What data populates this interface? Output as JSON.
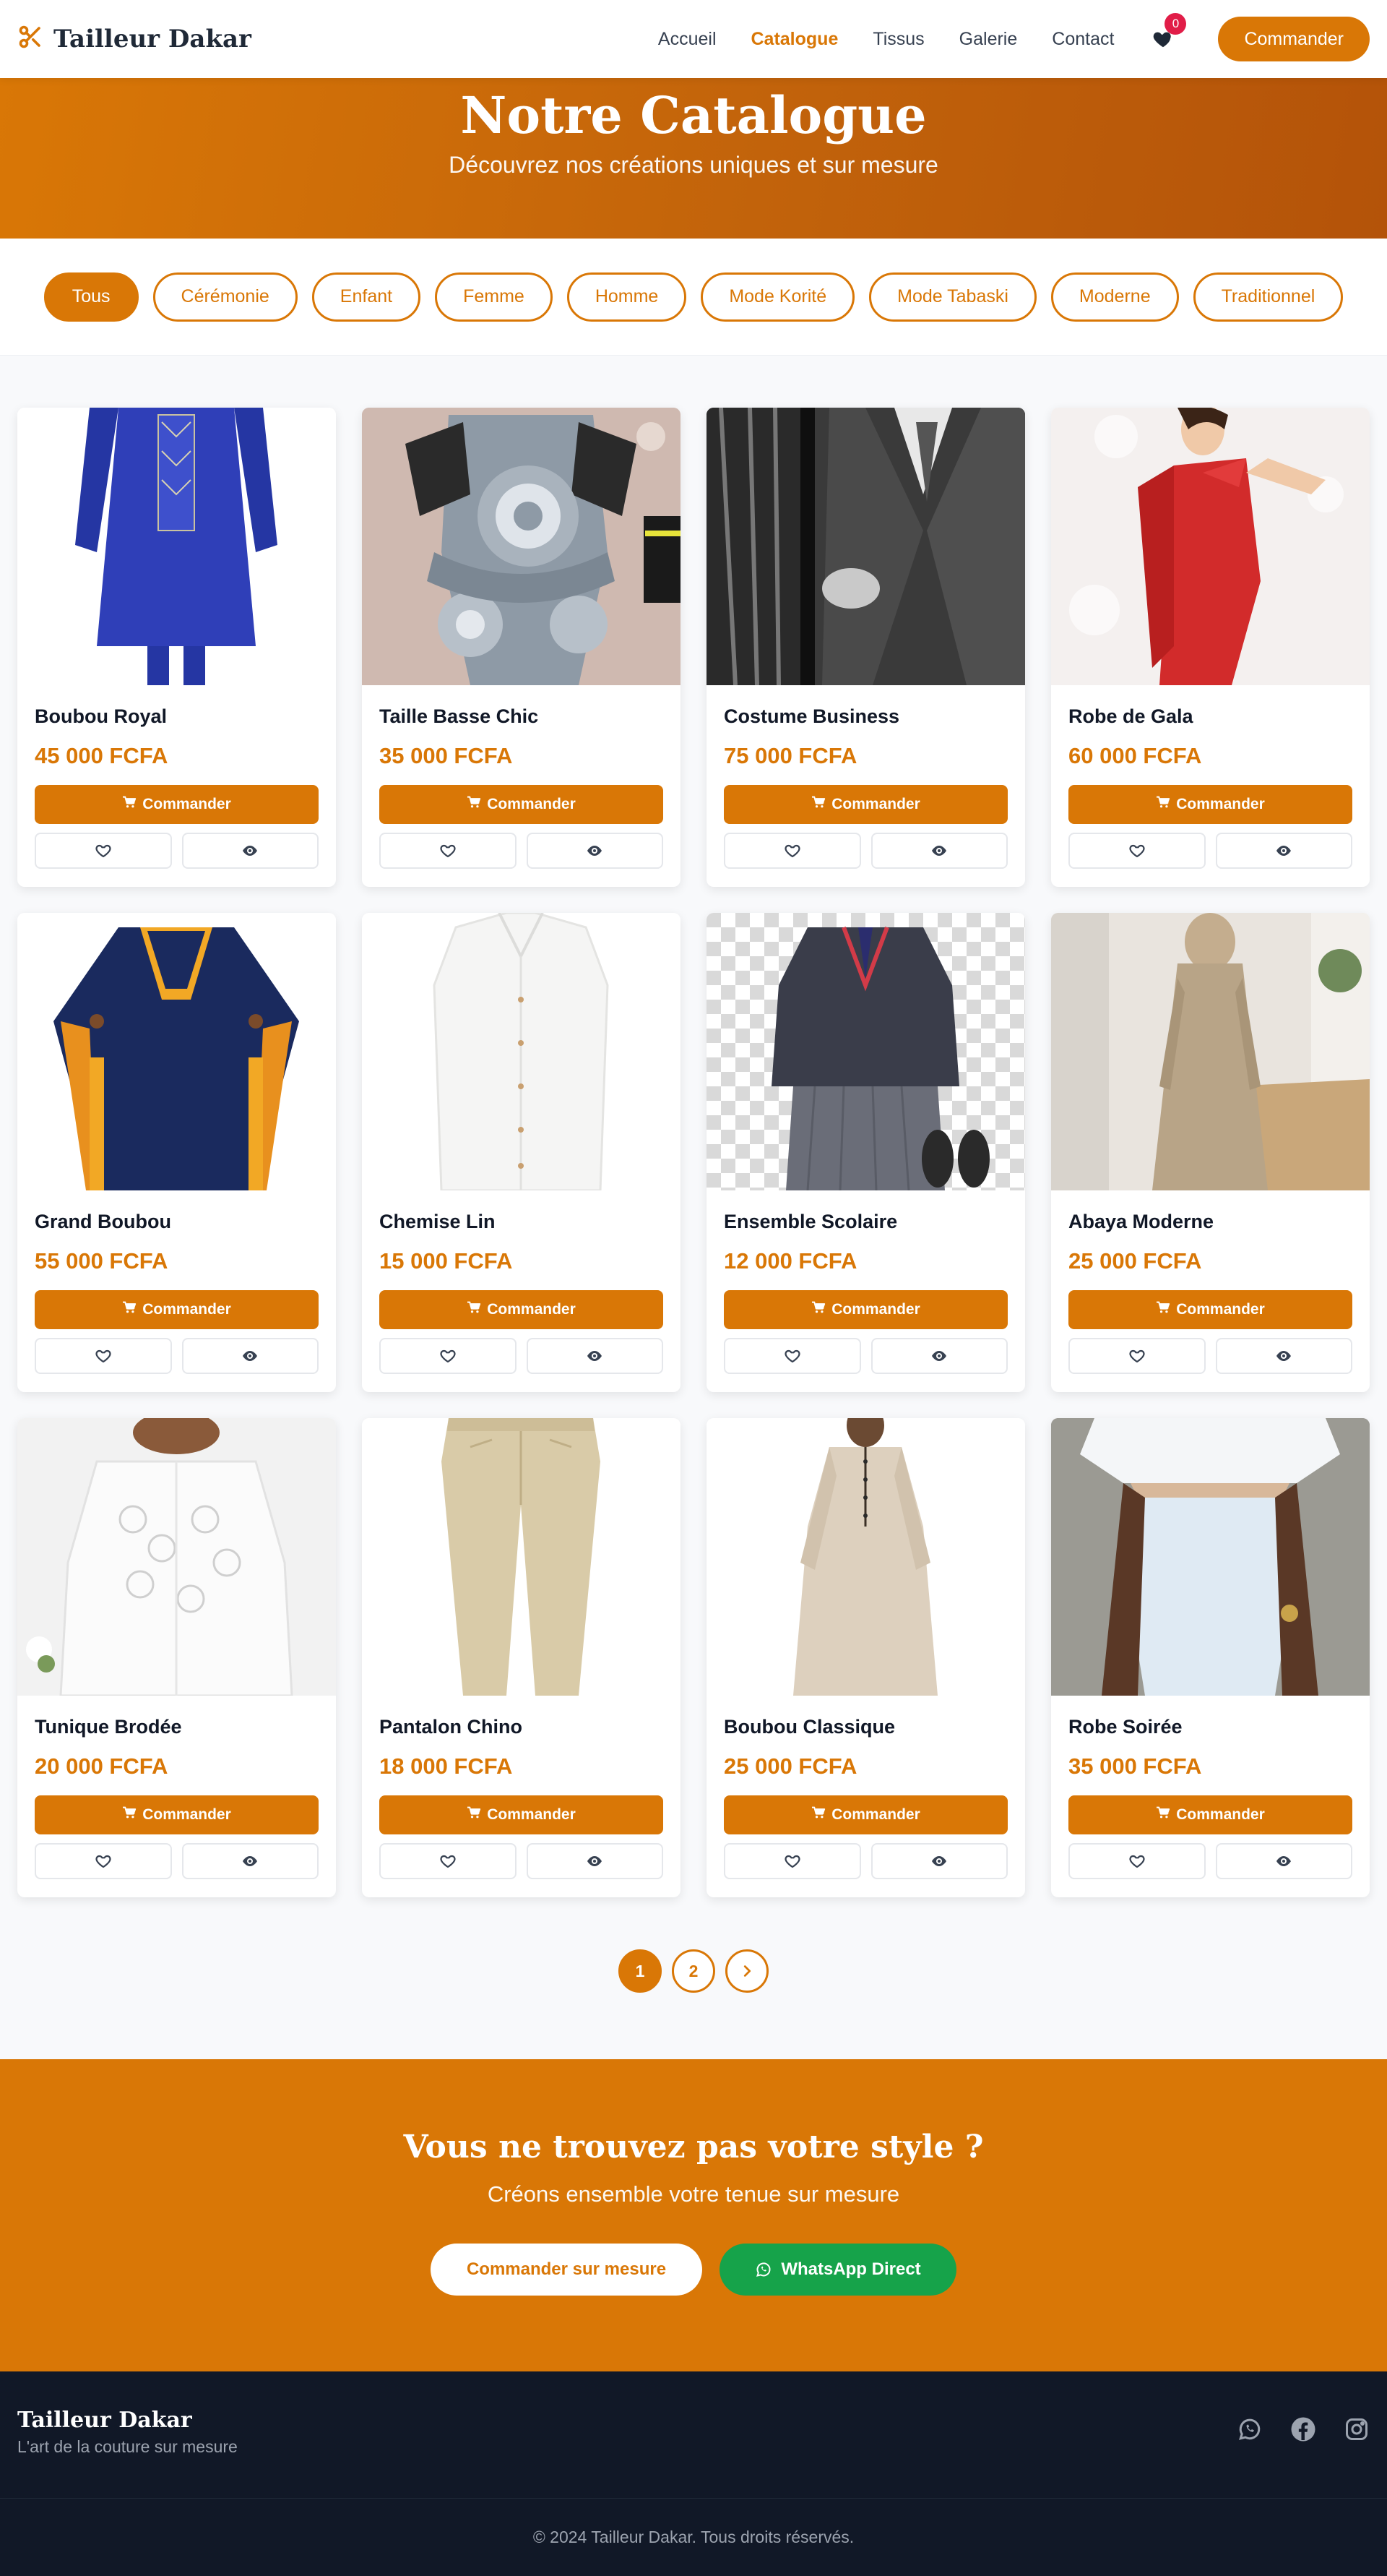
{
  "brand": {
    "name": "Tailleur Dakar",
    "icon": "scissors-icon",
    "accent": "#d97706"
  },
  "nav": {
    "links": [
      "Accueil",
      "Catalogue",
      "Tissus",
      "Galerie",
      "Contact"
    ],
    "active": "Catalogue",
    "wishlist_count": "0",
    "cta": "Commander"
  },
  "hero": {
    "title": "Notre Catalogue",
    "subtitle": "Découvrez nos créations uniques et sur mesure"
  },
  "filters": [
    "Tous",
    "Cérémonie",
    "Enfant",
    "Femme",
    "Homme",
    "Mode Korité",
    "Mode Tabaski",
    "Moderne",
    "Traditionnel"
  ],
  "active_filter": "Tous",
  "order_label": "Commander",
  "products": [
    {
      "name": "Boubou Royal",
      "price": "45 000 FCFA"
    },
    {
      "name": "Taille Basse Chic",
      "price": "35 000 FCFA"
    },
    {
      "name": "Costume Business",
      "price": "75 000 FCFA"
    },
    {
      "name": "Robe de Gala",
      "price": "60 000 FCFA"
    },
    {
      "name": "Grand Boubou",
      "price": "55 000 FCFA"
    },
    {
      "name": "Chemise Lin",
      "price": "15 000 FCFA"
    },
    {
      "name": "Ensemble Scolaire",
      "price": "12 000 FCFA"
    },
    {
      "name": "Abaya Moderne",
      "price": "25 000 FCFA"
    },
    {
      "name": "Tunique Brodée",
      "price": "20 000 FCFA"
    },
    {
      "name": "Pantalon Chino",
      "price": "18 000 FCFA"
    },
    {
      "name": "Boubou Classique",
      "price": "25 000 FCFA"
    },
    {
      "name": "Robe Soirée",
      "price": "35 000 FCFA"
    }
  ],
  "pagination": {
    "pages": [
      "1",
      "2"
    ],
    "current": "1"
  },
  "cta": {
    "title": "Vous ne trouvez pas votre style ?",
    "subtitle": "Créons ensemble votre tenue sur mesure",
    "primary": "Commander sur mesure",
    "whatsapp": "WhatsApp Direct"
  },
  "footer": {
    "brand": "Tailleur Dakar",
    "tagline": "L'art de la couture sur mesure",
    "copyright": "© 2024 Tailleur Dakar. Tous droits réservés.",
    "socials": [
      "whatsapp-icon",
      "facebook-icon",
      "instagram-icon"
    ]
  }
}
